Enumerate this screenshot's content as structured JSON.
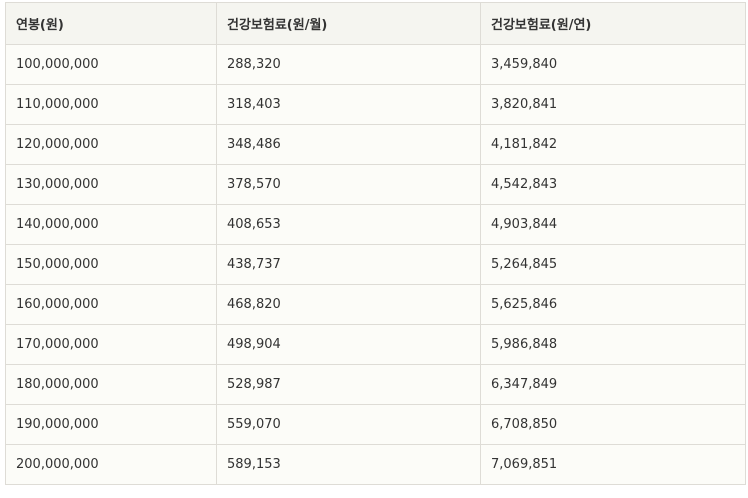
{
  "table": {
    "headers": [
      "연봉(원)",
      "건강보험료(원/월)",
      "건강보험료(원/연)"
    ],
    "rows": [
      [
        "100,000,000",
        "288,320",
        "3,459,840"
      ],
      [
        "110,000,000",
        "318,403",
        "3,820,841"
      ],
      [
        "120,000,000",
        "348,486",
        "4,181,842"
      ],
      [
        "130,000,000",
        "378,570",
        "4,542,843"
      ],
      [
        "140,000,000",
        "408,653",
        "4,903,844"
      ],
      [
        "150,000,000",
        "438,737",
        "5,264,845"
      ],
      [
        "160,000,000",
        "468,820",
        "5,625,846"
      ],
      [
        "170,000,000",
        "498,904",
        "5,986,848"
      ],
      [
        "180,000,000",
        "528,987",
        "6,347,849"
      ],
      [
        "190,000,000",
        "559,070",
        "6,708,850"
      ],
      [
        "200,000,000",
        "589,153",
        "7,069,851"
      ]
    ]
  }
}
